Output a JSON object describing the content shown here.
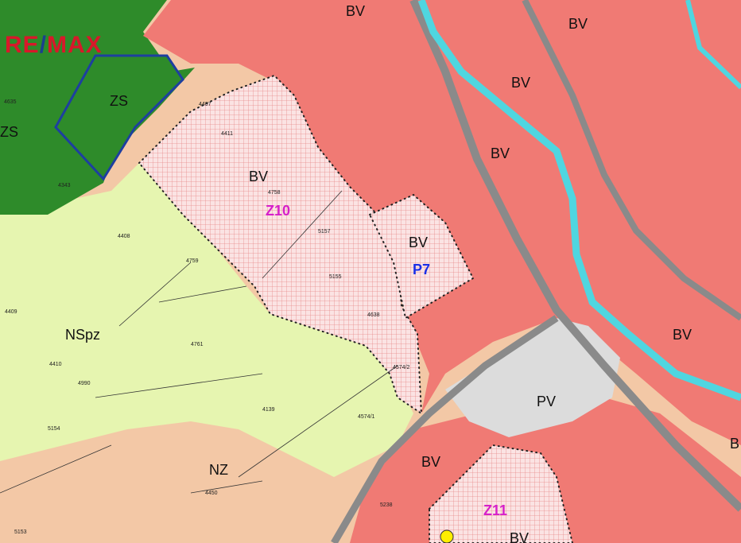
{
  "logo": {
    "text": "RE/MAX",
    "colors": {
      "red": "#d8182a",
      "blue": "#1b3f8f"
    }
  },
  "legend_colors": {
    "BV": "#f07a74",
    "ZS": "#2e8b2a",
    "NSpz": "#e6f5b0",
    "NZ": "#f3c8a6",
    "PV": "#dcdcdc",
    "water": "#4fd6e0"
  },
  "zones": {
    "bv_top": "BV",
    "bv_right1": "BV",
    "bv_mid": "BV",
    "bv_center": "BV",
    "bv_z10": "BV",
    "bv_p7": "BV",
    "bv_east": "BV",
    "bv_se": "BV",
    "bv_south": "BV",
    "bv_bottom": "BV",
    "bv_edge": "B",
    "zs1": "ZS",
    "zs2": "ZS",
    "nspz": "NSpz",
    "nz": "NZ",
    "pv": "PV"
  },
  "areas": {
    "z10": "Z10",
    "p7": "P7",
    "z11": "Z11"
  },
  "parcels": {
    "p4635": "4635",
    "p4343": "4343",
    "p4407": "4407",
    "p4411": "4411",
    "p4758": "4758",
    "p4408": "4408",
    "p4759": "4759",
    "p4409": "4409",
    "p4410": "4410",
    "p4761": "4761",
    "p5157": "5157",
    "p5155": "5155",
    "p4638": "4638",
    "p4574_2": "4574/2",
    "p4574_1": "4574/1",
    "p4139": "4139",
    "p5154": "5154",
    "p5153": "5153",
    "p5238": "5238",
    "p5160": "5160",
    "p4990": "4990",
    "p4450": "4450"
  }
}
